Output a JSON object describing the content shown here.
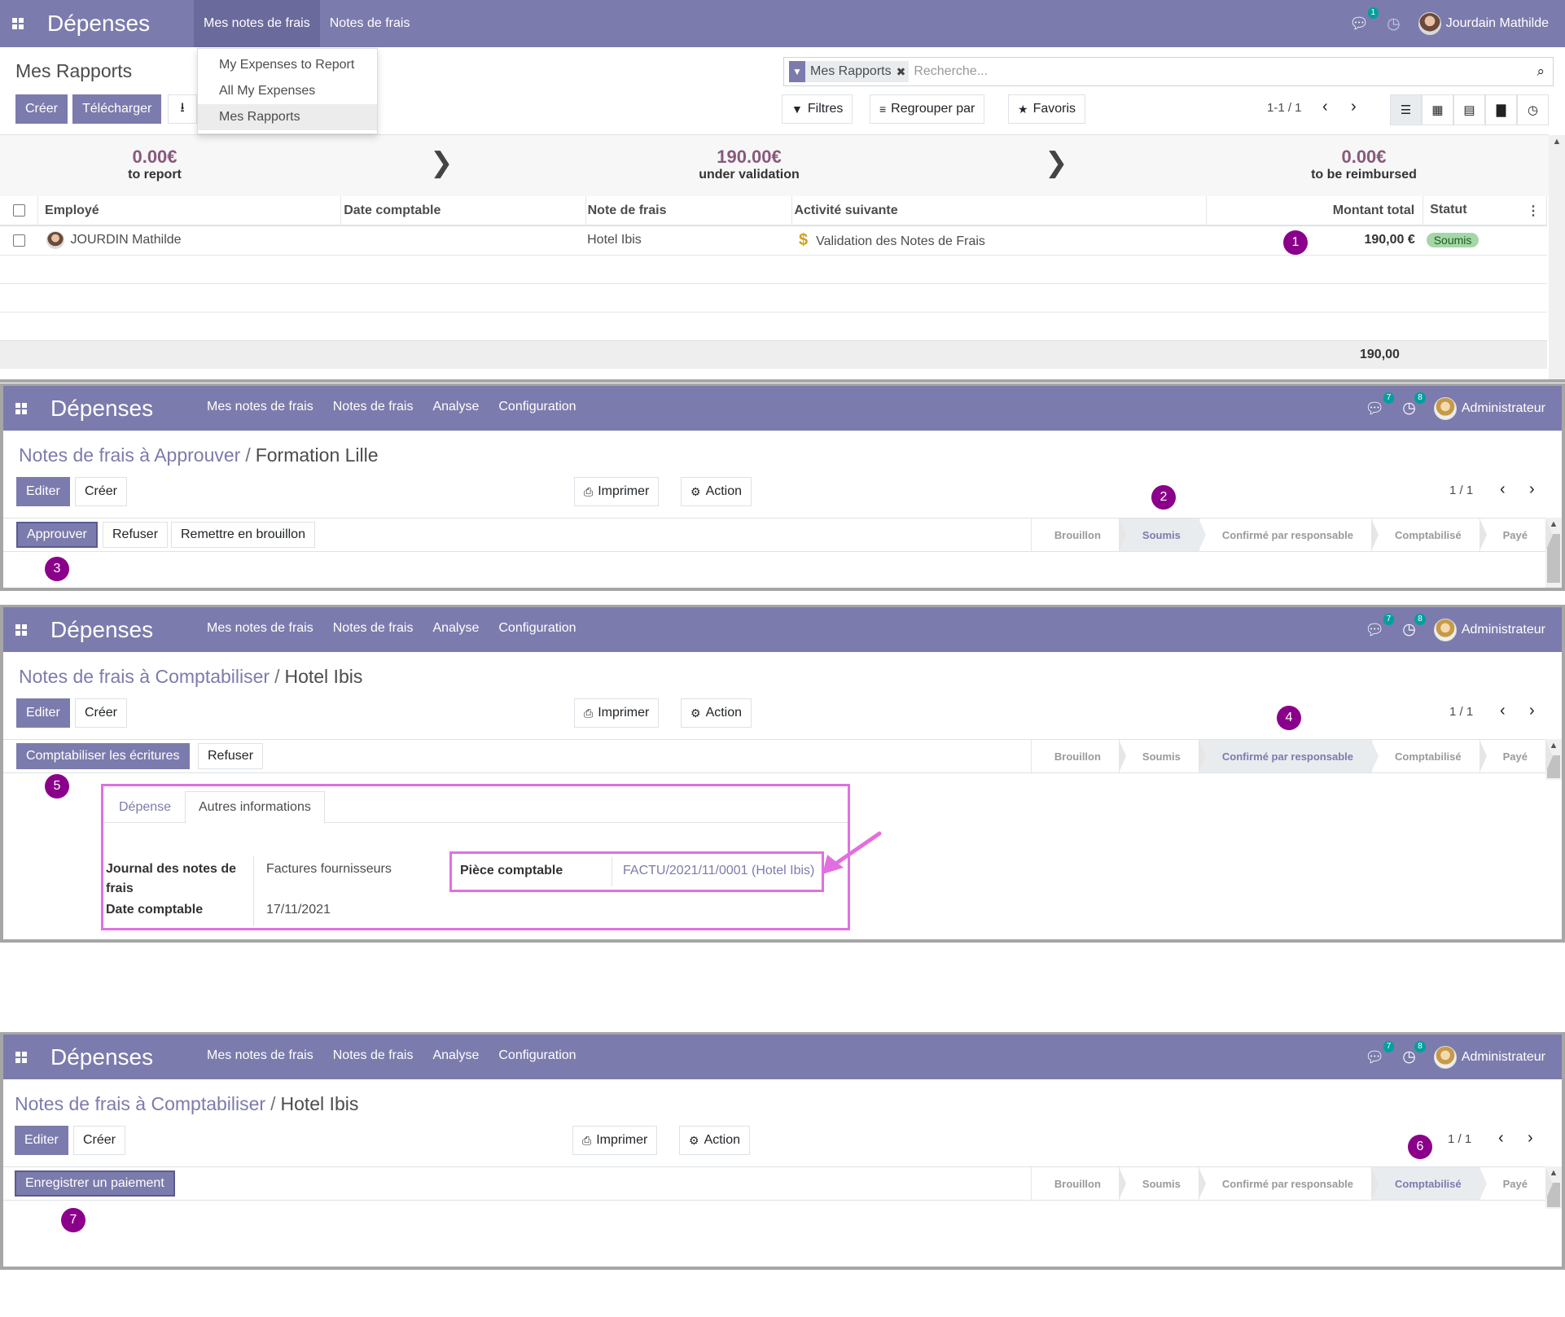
{
  "app": {
    "brand": "Dépenses"
  },
  "panel1": {
    "menu": [
      "Mes notes de frais",
      "Notes de frais"
    ],
    "dropdown": [
      "My Expenses to Report",
      "All My Expenses",
      "Mes Rapports"
    ],
    "chat_badge": "1",
    "user": "Jourdain Mathilde",
    "title": "Mes Rapports",
    "buttons": {
      "create": "Créer",
      "download": "Télécharger"
    },
    "search": {
      "facet": "Mes Rapports",
      "placeholder": "Recherche..."
    },
    "filters": {
      "filters": "Filtres",
      "group_by": "Regrouper par",
      "favorites": "Favoris"
    },
    "pager": "1-1 / 1",
    "dashboard": [
      {
        "value": "0.00€",
        "label": "to report"
      },
      {
        "value": "190.00€",
        "label": "under validation"
      },
      {
        "value": "0.00€",
        "label": "to be reimbursed"
      }
    ],
    "columns": [
      "Employé",
      "Date comptable",
      "Note de frais",
      "Activité suivante",
      "Montant total",
      "Statut"
    ],
    "row": {
      "employee": "JOURDIN Mathilde",
      "date": "",
      "note": "Hotel Ibis",
      "activity": "Validation des Notes de Frais",
      "amount": "190,00 €",
      "status": "Soumis"
    },
    "total": "190,00",
    "marker": "1"
  },
  "panel2": {
    "menu": [
      "Mes notes de frais",
      "Notes de frais",
      "Analyse",
      "Configuration"
    ],
    "chat_badge": "7",
    "activity_badge": "8",
    "user": "Administrateur",
    "breadcrumb": {
      "parent": "Notes de frais à Approuver",
      "current": "Formation Lille"
    },
    "buttons": {
      "edit": "Editer",
      "create": "Créer",
      "print": "Imprimer",
      "action": "Action"
    },
    "pager": "1 / 1",
    "status_buttons": [
      "Approuver",
      "Refuser",
      "Remettre en brouillon"
    ],
    "stages": [
      "Brouillon",
      "Soumis",
      "Confirmé par responsable",
      "Comptabilisé",
      "Payé"
    ],
    "active_stage": "Soumis",
    "markers": [
      "2",
      "3"
    ]
  },
  "panel3": {
    "menu": [
      "Mes notes de frais",
      "Notes de frais",
      "Analyse",
      "Configuration"
    ],
    "chat_badge": "7",
    "activity_badge": "8",
    "user": "Administrateur",
    "breadcrumb": {
      "parent": "Notes de frais à Comptabiliser",
      "current": "Hotel Ibis"
    },
    "buttons": {
      "edit": "Editer",
      "create": "Créer",
      "print": "Imprimer",
      "action": "Action"
    },
    "pager": "1 / 1",
    "status_buttons": [
      "Comptabiliser les écritures",
      "Refuser"
    ],
    "stages": [
      "Brouillon",
      "Soumis",
      "Confirmé par responsable",
      "Comptabilisé",
      "Payé"
    ],
    "active_stage": "Confirmé par responsable",
    "tabs": [
      "Dépense",
      "Autres informations"
    ],
    "fields": {
      "journal_label": "Journal des notes de frais",
      "journal_value": "Factures fournisseurs",
      "date_label": "Date comptable",
      "date_value": "17/11/2021",
      "piece_label": "Pièce comptable",
      "piece_value": "FACTU/2021/11/0001 (Hotel Ibis)"
    },
    "markers": [
      "4",
      "5"
    ]
  },
  "panel4": {
    "menu": [
      "Mes notes de frais",
      "Notes de frais",
      "Analyse",
      "Configuration"
    ],
    "chat_badge": "7",
    "activity_badge": "8",
    "user": "Administrateur",
    "breadcrumb": {
      "parent": "Notes de frais à Comptabiliser",
      "current": "Hotel Ibis"
    },
    "buttons": {
      "edit": "Editer",
      "create": "Créer",
      "print": "Imprimer",
      "action": "Action"
    },
    "pager": "1 / 1",
    "status_buttons": [
      "Enregistrer un paiement"
    ],
    "stages": [
      "Brouillon",
      "Soumis",
      "Confirmé par responsable",
      "Comptabilisé",
      "Payé"
    ],
    "active_stage": "Comptabilisé",
    "markers": [
      "6",
      "7"
    ]
  },
  "colors": {
    "navbar": "#7c7bad",
    "marker": "#8b008b",
    "highlight": "#e070e0",
    "status_pill": "#a5d6a7",
    "dashboard_value": "#875a7b"
  },
  "icons": [
    "apps-grid-icon",
    "chat-icon",
    "clock-icon",
    "filter-icon",
    "search-icon",
    "list-view-icon",
    "kanban-view-icon",
    "pivot-view-icon",
    "graph-view-icon",
    "activity-view-icon",
    "print-icon",
    "gear-icon",
    "dollar-icon",
    "chevron-left-icon",
    "chevron-right-icon",
    "download-icon",
    "star-icon"
  ]
}
